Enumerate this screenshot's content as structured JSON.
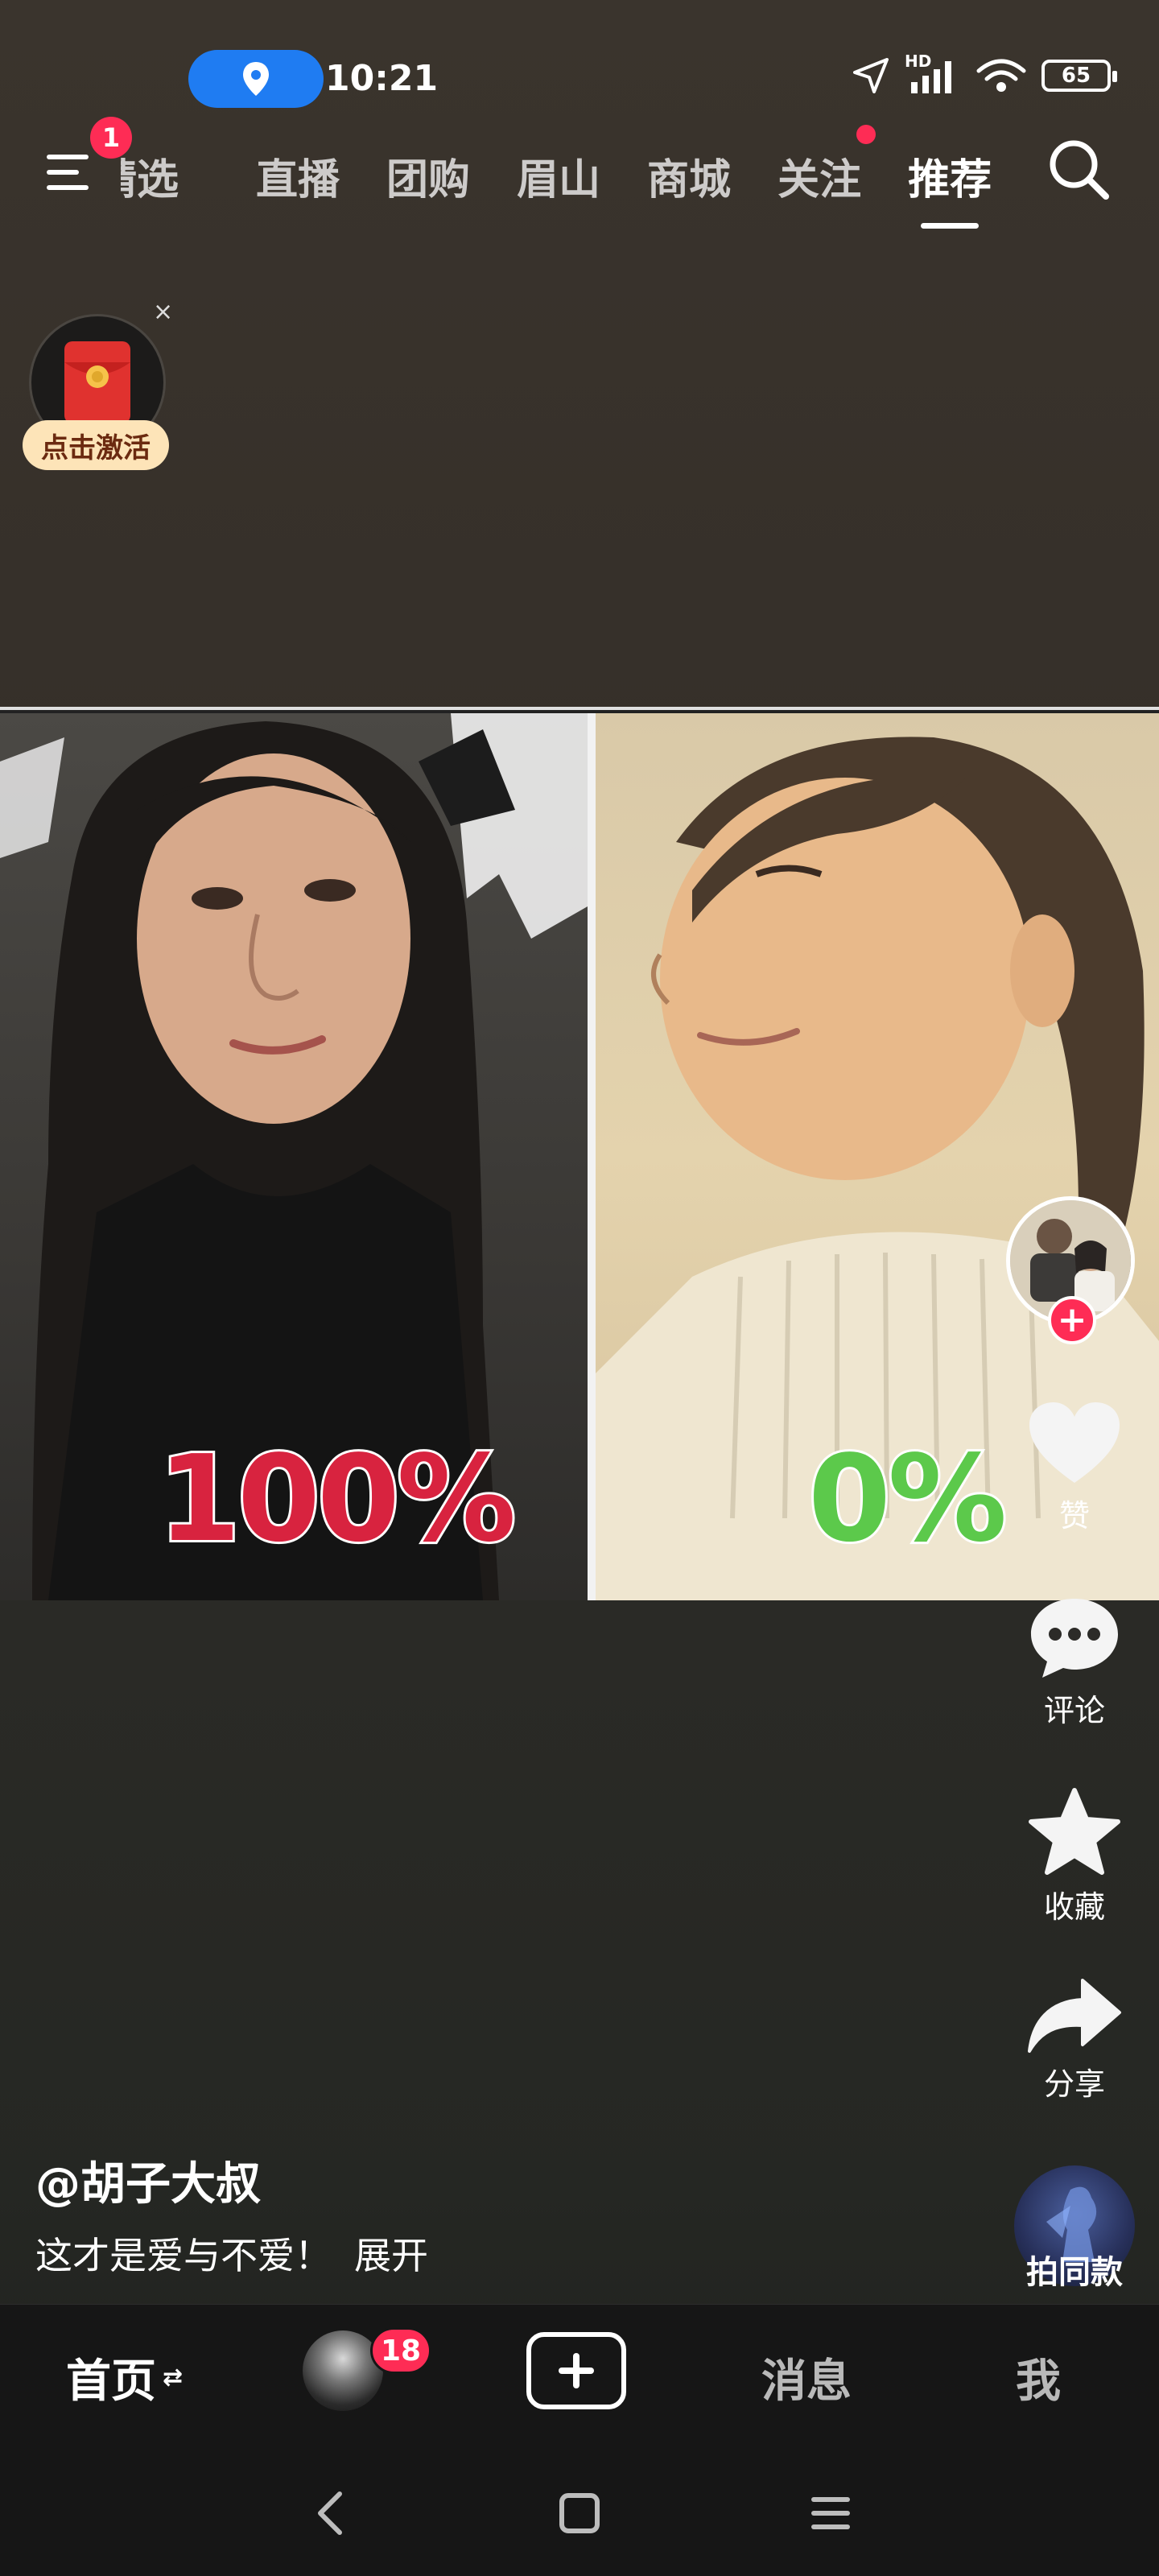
{
  "status_bar": {
    "time": "10:21",
    "network_label": "HD",
    "battery": "65"
  },
  "top_nav": {
    "menu_badge": "1",
    "tabs": [
      {
        "label": "精选"
      },
      {
        "label": "直播"
      },
      {
        "label": "团购"
      },
      {
        "label": "眉山"
      },
      {
        "label": "商城"
      },
      {
        "label": "关注"
      },
      {
        "label": "推荐"
      }
    ],
    "active_tab": "推荐"
  },
  "red_packet": {
    "label": "点击激活",
    "close": "×"
  },
  "video": {
    "left_percent": "100%",
    "right_percent": "0%"
  },
  "actions": {
    "follow_plus": "+",
    "like_label": "赞",
    "comment_label": "评论",
    "favorite_label": "收藏",
    "share_label": "分享",
    "same_style_label": "拍同款"
  },
  "caption": {
    "author": "@胡子大叔",
    "text": "这才是爱与不爱！",
    "expand": "展开"
  },
  "bottom_bar": {
    "home": "首页",
    "home_swap": "⇄",
    "friends_badge": "18",
    "messages": "消息",
    "me": "我"
  },
  "colors": {
    "accent_red": "#fe2c55",
    "location_blue": "#1f7cf2",
    "percent_red": "#d8233f",
    "percent_green": "#5cc94b"
  }
}
